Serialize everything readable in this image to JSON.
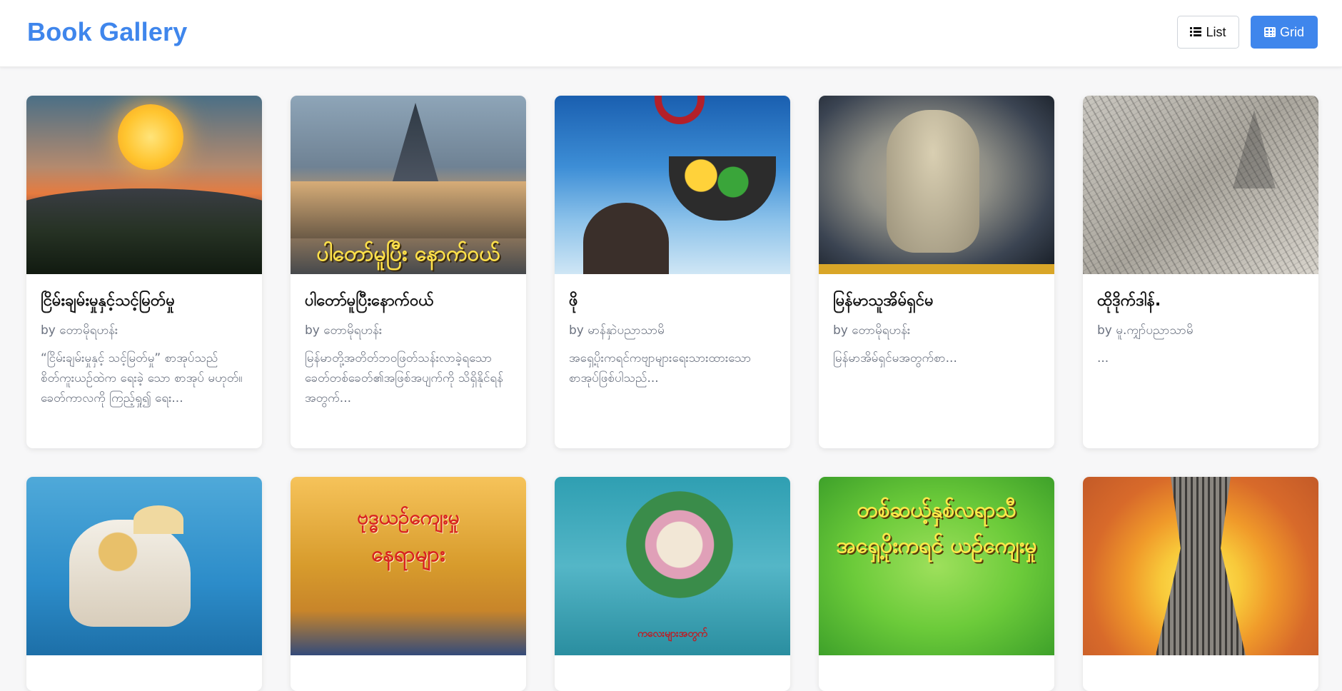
{
  "header": {
    "title": "Book Gallery",
    "list_label": "List",
    "grid_label": "Grid"
  },
  "books": [
    {
      "title": "ငြိမ်းချမ်းမှုနှင့်သင့်မြတ်မှု",
      "author": "by တောမိုရဟန်း",
      "description": "“ငြိမ်းချမ်းမှုနှင့် သင့်မြတ်မှု” စာအုပ်သည် စိတ်ကူးယဉ်ထဲက ရေးခဲ့ သော စာအုပ် မဟုတ်။ ခေတ်ကာလကို ကြည့်ရှု၍ ရေး..."
    },
    {
      "title": "ပါတော်မူပြီးနောက်ဝယ်",
      "author": "by တောမိုရဟန်း",
      "description": "မြန်မာတို့အတိတ်ဘဝဖြတ်သန်းလာခဲ့ရသောခေတ်တစ်ခေတ်၏အဖြစ်အပျက်ကို သိရှိနိုင်ရန်အတွက်...",
      "cover_text": "ပါတော်မူပြီး နောက်ဝယ်"
    },
    {
      "title": "ဖို",
      "author": "by မာန်နှာဲပညာသာမိ",
      "description": "အရှေ့ပိုးကရင်ကဗျာများရေးသားထားသောစာအုပ်ဖြစ်ပါသည်..."
    },
    {
      "title": "မြန်မာသူအိမ်ရှင်မ",
      "author": "by တောမိုရဟန်း",
      "description": "မြန်မာအိမ်ရှင်မအတွက်စာ..."
    },
    {
      "title": "ထိုဒိုက်ဒါန်.",
      "author": "by မူ.ကျှာ်ပညာသာမိ",
      "description": "..."
    }
  ],
  "row2_covers": [
    {
      "name": "cover-6"
    },
    {
      "name": "cover-7",
      "line1": "ဗုဒ္ဓယဉ်ကျေးမှု",
      "line2": "နေရာများ"
    },
    {
      "name": "cover-8",
      "line1": "ကလေးများအတွက်"
    },
    {
      "name": "cover-9",
      "line1": "တစ်ဆယ့်နှစ်လရာသီ",
      "line2": "အရှေ့ပိုးကရင် ယဉ်ကျေးမှု"
    },
    {
      "name": "cover-10"
    }
  ],
  "colors": {
    "accent": "#3f86ec",
    "background": "#f7f7f8",
    "card": "#ffffff",
    "muted_text": "#6b7280"
  },
  "icons": {
    "list": "list-icon",
    "grid": "grid-icon"
  }
}
